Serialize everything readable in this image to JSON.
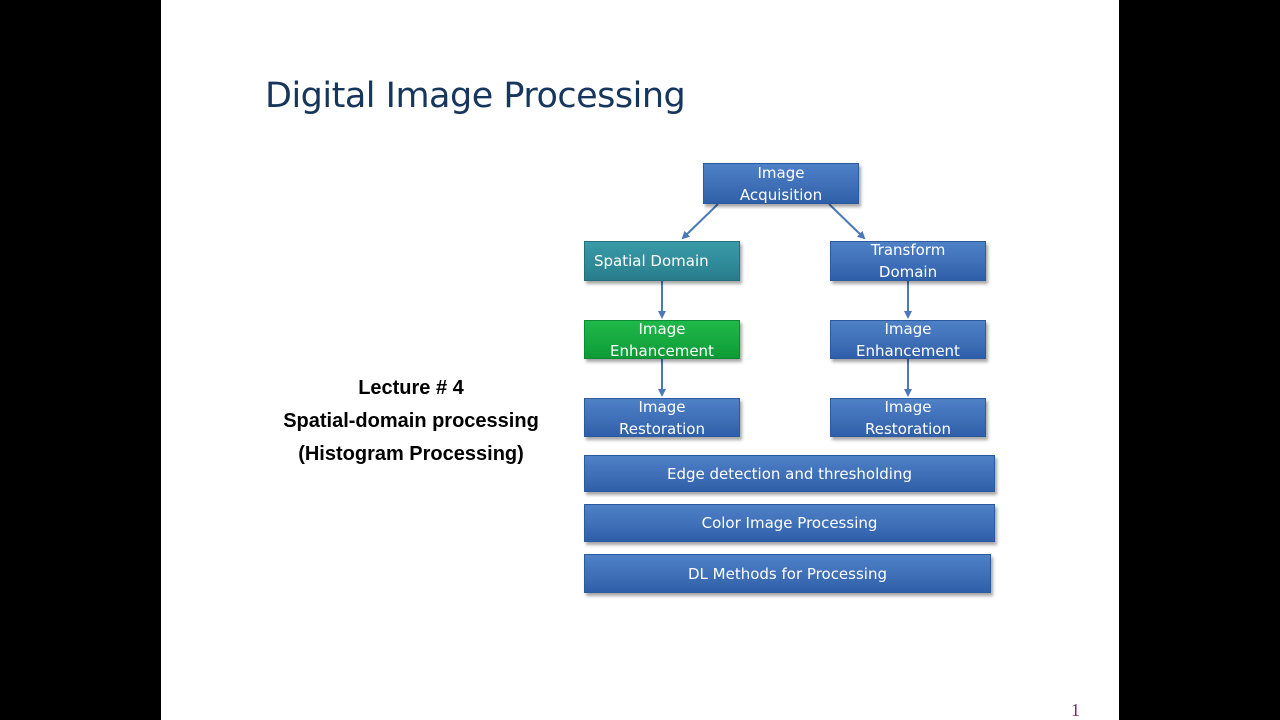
{
  "slide": {
    "title": "Digital Image Processing",
    "lecture": {
      "line1": "Lecture # 4",
      "line2": "Spatial-domain processing",
      "line3": "(Histogram Processing)"
    },
    "page_number": "1"
  },
  "diagram": {
    "nodes": {
      "acquisition": {
        "line1": "Image",
        "line2": "Acquisition"
      },
      "spatial": {
        "line1": "Spatial Domain"
      },
      "transform": {
        "line1": "Transform",
        "line2": "Domain"
      },
      "enh_left": {
        "line1": "Image",
        "line2": "Enhancement"
      },
      "enh_right": {
        "line1": "Image",
        "line2": "Enhancement"
      },
      "rest_left": {
        "line1": "Image",
        "line2": "Restoration"
      },
      "rest_right": {
        "line1": "Image",
        "line2": "Restoration"
      },
      "edge": {
        "line1": "Edge detection and thresholding"
      },
      "color": {
        "line1": "Color Image Processing"
      },
      "dl": {
        "line1": "DL Methods for Processing"
      }
    },
    "colors": {
      "blue": "#3e6fb7",
      "teal": "#2f8a98",
      "green": "#14a83f",
      "arrow": "#4a78b8",
      "title": "#17365d"
    }
  }
}
